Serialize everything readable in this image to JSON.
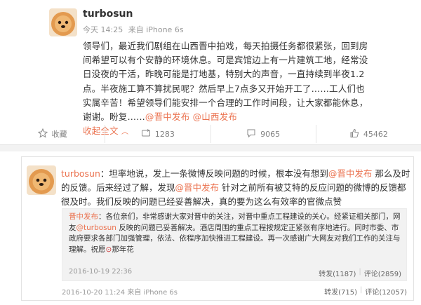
{
  "post": {
    "username": "turbosun",
    "time": "今天 14:25",
    "source": "来自 iPhone 6s",
    "text_before": "领导们，最近我们剧组在山西晋中拍戏，每天拍摄任务都很紧张，回到房间希望可以有个安静的环境休息。可是宾馆边上有一片建筑工地，经常没日没夜的干活，昨晚可能是打地基，特别大的声音，一直持续到半夜1.2点。半夜施工算不算扰民呢？然后早上7点多又开始开工了……工人们也实属辛苦！希望领导们能安排一个合理的工作时间段，让大家都能休息，谢谢。盼复……",
    "mention1": "@晋中发布",
    "mention2": "@山西发布",
    "collapse_label": "收起全文",
    "collapse_icon": "chevron-up-icon"
  },
  "actions": [
    {
      "label": "收藏",
      "icon": "star-icon"
    },
    {
      "label": "1283",
      "icon": "repost-icon"
    },
    {
      "label": "9065",
      "icon": "comment-icon"
    },
    {
      "label": "45462",
      "icon": "thumbs-up-icon"
    }
  ],
  "reply": {
    "username": "turbosun",
    "text_part1": "：坦率地说，发上一条微博反映问题的时候，根本没有想到",
    "mention1": "@晋中发布",
    "text_part2": "那么及时的反馈。后来经过了解，发现",
    "mention2": "@晋中发布",
    "text_part3": "针对之前所有被艾特的反应问题的微博的反馈都很及时。我们反映的问题已经妥善解决，真的要为这么有效率的官微点赞",
    "time": "2016-10-20 11:24",
    "source": "来自 iPhone 6s",
    "repost": "转发(715)",
    "comment": "评论(12057)"
  },
  "quoted": {
    "username": "晋中发布",
    "text_part1": "：各位亲们，非常感谢大家对晋中的关注，对晋中重点工程建设的关心。经紧证相关部门，网友",
    "mention": "@turbosun",
    "text_part2": "反映的问题已妥善解决。酒店周围的重点工程按规定正紧张有序地进行。同时市委、市政府要求各部门加强管理，依法、依程序加快推进工程建设。再一次感谢广大网友对我们工作的关注与理解。祝愿",
    "emoji_label": "⊙",
    "text_part3": "那年花",
    "time": "2016-10-19 22:36",
    "repost": "转发(1187)",
    "comment": "评论(2859)"
  }
}
